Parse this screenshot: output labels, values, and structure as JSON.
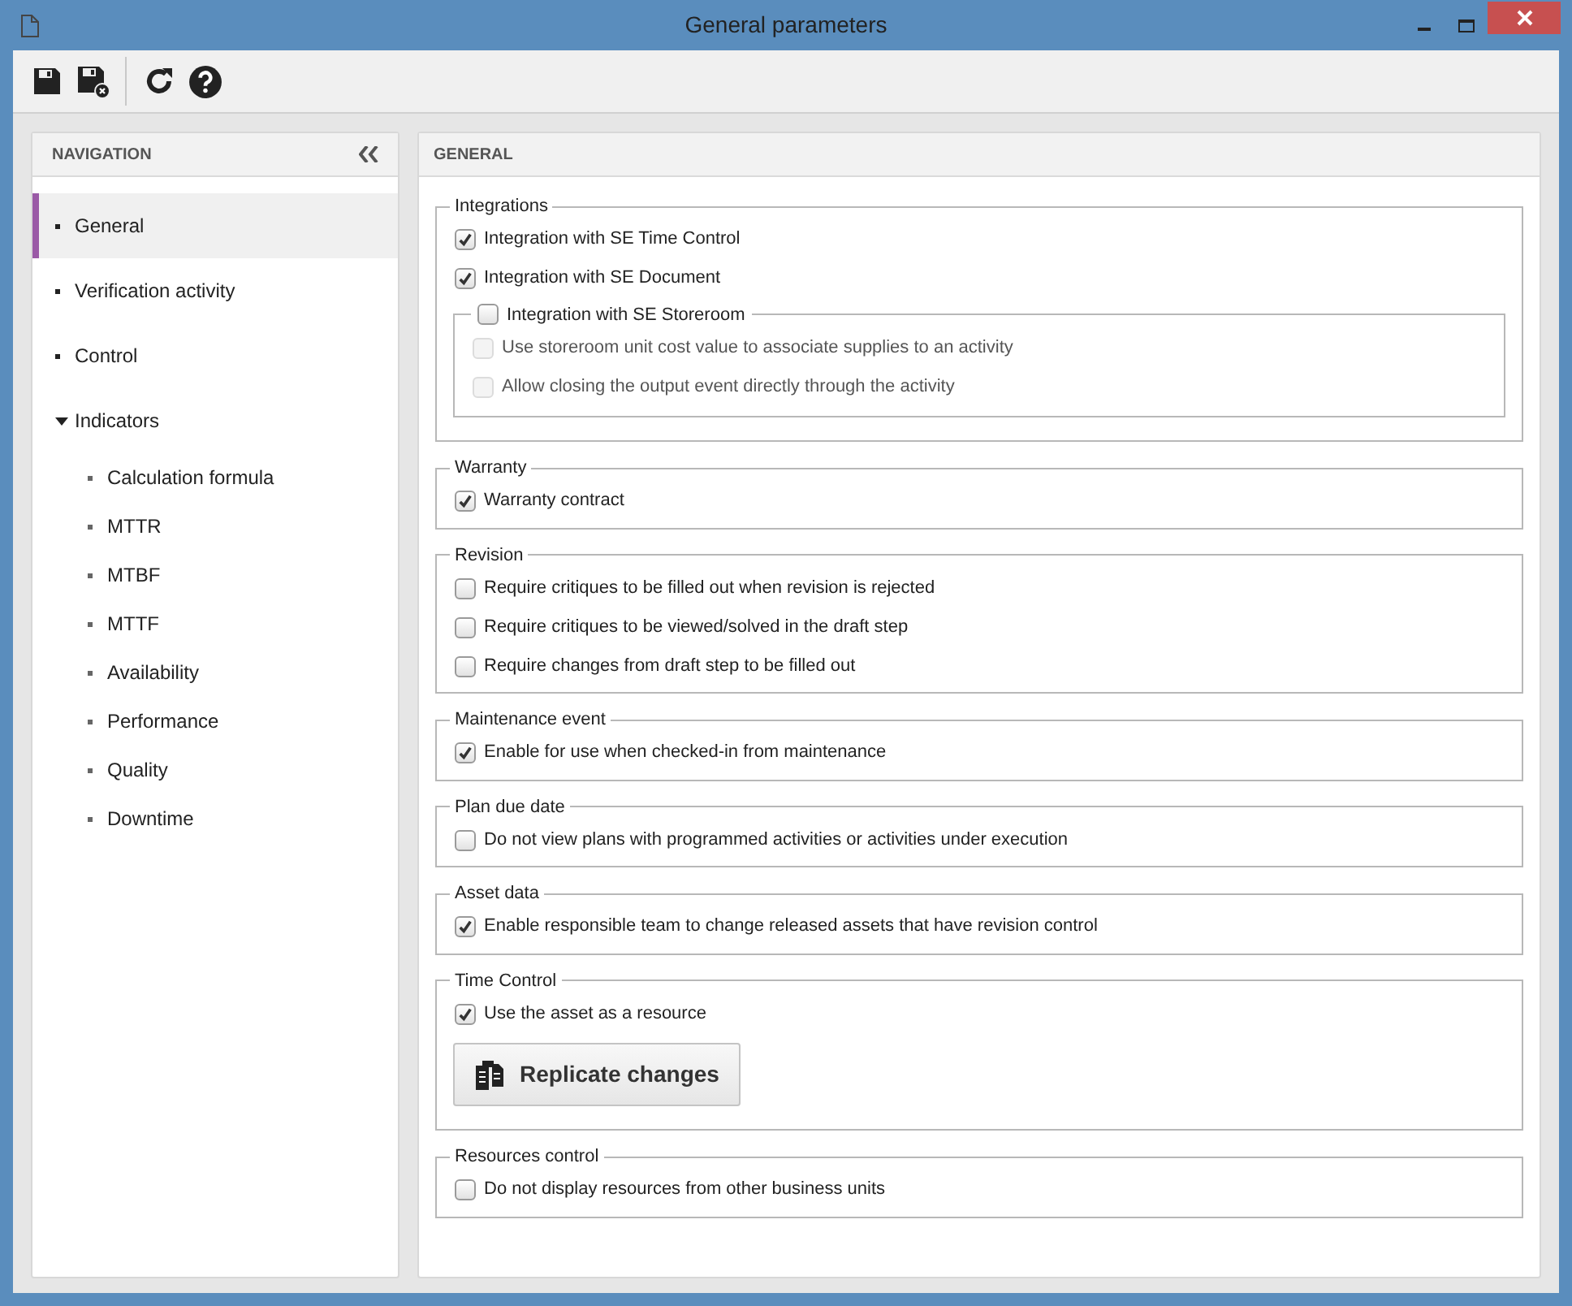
{
  "window": {
    "title": "General parameters"
  },
  "toolbar": [
    {
      "kind": "save"
    },
    {
      "kind": "save-close"
    },
    {
      "kind": "separator"
    },
    {
      "kind": "refresh"
    },
    {
      "kind": "help"
    }
  ],
  "navigation": {
    "title": "NAVIGATION",
    "items": [
      {
        "label": "General",
        "selected": true
      },
      {
        "label": "Verification activity",
        "selected": false
      },
      {
        "label": "Control",
        "selected": false
      },
      {
        "label": "Indicators",
        "selected": false,
        "expanded": true,
        "children": [
          {
            "label": "Calculation formula",
            "selected": false
          },
          {
            "label": "MTTR",
            "selected": false
          },
          {
            "label": "MTBF",
            "selected": false
          },
          {
            "label": "MTTF",
            "selected": false
          },
          {
            "label": "Availability",
            "selected": false
          },
          {
            "label": "Performance",
            "selected": false
          },
          {
            "label": "Quality",
            "selected": false
          },
          {
            "label": "Downtime",
            "selected": false
          }
        ]
      }
    ]
  },
  "main": {
    "title": "GENERAL",
    "groups": [
      {
        "legend": "Integrations",
        "items": [
          {
            "kind": "checkbox",
            "label": "Integration with SE Time Control",
            "checked": true,
            "disabled": false
          },
          {
            "kind": "checkbox",
            "label": "Integration with SE Document",
            "checked": true,
            "disabled": false
          },
          {
            "kind": "subgroup",
            "label": "Integration with SE Storeroom",
            "checked": false,
            "disabled": false,
            "items": [
              {
                "kind": "checkbox",
                "label": "Use storeroom unit cost value to associate supplies to an activity",
                "checked": false,
                "disabled": true
              },
              {
                "kind": "checkbox",
                "label": "Allow closing the output event directly through the activity",
                "checked": false,
                "disabled": true
              }
            ]
          }
        ]
      },
      {
        "legend": "Warranty",
        "items": [
          {
            "kind": "checkbox",
            "label": "Warranty contract",
            "checked": true,
            "disabled": false
          }
        ]
      },
      {
        "legend": "Revision",
        "items": [
          {
            "kind": "checkbox",
            "label": "Require critiques to be filled out when revision is rejected",
            "checked": false,
            "disabled": false
          },
          {
            "kind": "checkbox",
            "label": "Require critiques to be viewed/solved in the draft step",
            "checked": false,
            "disabled": false
          },
          {
            "kind": "checkbox",
            "label": "Require changes from draft step to be filled out",
            "checked": false,
            "disabled": false
          }
        ]
      },
      {
        "legend": "Maintenance event",
        "items": [
          {
            "kind": "checkbox",
            "label": "Enable for use when checked-in from maintenance",
            "checked": true,
            "disabled": false
          }
        ]
      },
      {
        "legend": "Plan due date",
        "items": [
          {
            "kind": "checkbox",
            "label": "Do not view plans with programmed activities or activities under execution",
            "checked": false,
            "disabled": false
          }
        ]
      },
      {
        "legend": "Asset data",
        "items": [
          {
            "kind": "checkbox",
            "label": "Enable responsible team to change released assets that have revision control",
            "checked": true,
            "disabled": false
          }
        ]
      },
      {
        "legend": "Time Control",
        "items": [
          {
            "kind": "checkbox",
            "label": "Use the asset as a resource",
            "checked": true,
            "disabled": false
          },
          {
            "kind": "button",
            "label": "Replicate changes"
          }
        ]
      },
      {
        "legend": "Resources control",
        "items": [
          {
            "kind": "checkbox",
            "label": "Do not display resources from other business units",
            "checked": false,
            "disabled": false
          }
        ]
      }
    ]
  }
}
